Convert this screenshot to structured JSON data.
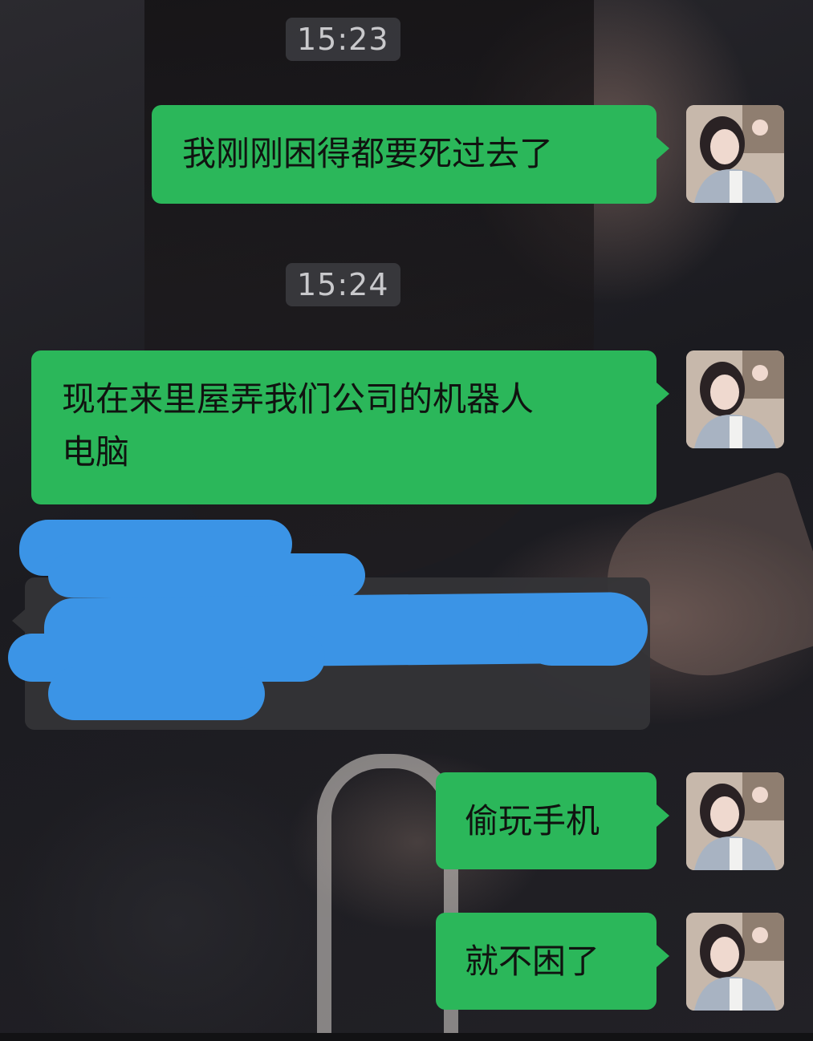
{
  "chat": {
    "timestamps": [
      "15:23",
      "15:24"
    ],
    "messages": [
      {
        "side": "right",
        "text": "我刚刚困得都要死过去了"
      },
      {
        "side": "right",
        "text": "现在来里屋弄我们公司的机器人\n电脑"
      },
      {
        "side": "left",
        "text": "",
        "redacted": true
      },
      {
        "side": "right",
        "text": "偷玩手机"
      },
      {
        "side": "right",
        "text": "就不困了"
      }
    ]
  },
  "colors": {
    "bubble_green": "#2bb75a",
    "bubble_gray": "#343437",
    "redaction_blue": "#3b94e6",
    "timestamp_text": "#c9c9cc"
  },
  "icons": {
    "avatar": "user-avatar-photo"
  }
}
